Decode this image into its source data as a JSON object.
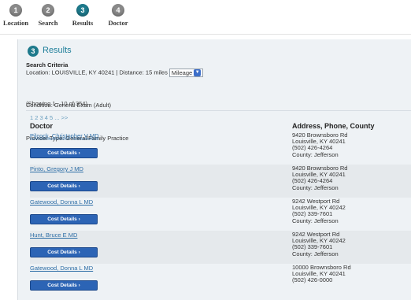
{
  "steps": [
    {
      "num": "1",
      "label": "Location",
      "active": false
    },
    {
      "num": "2",
      "label": "Search",
      "active": false
    },
    {
      "num": "3",
      "label": "Results",
      "active": true
    },
    {
      "num": "4",
      "label": "Doctor",
      "active": false
    }
  ],
  "results": {
    "num": "3",
    "title": "Results",
    "criteria_heading": "Search Criteria",
    "location_text": "Location: LOUISVILLE, KY 40241 | Distance: 15 miles",
    "distance_unit": "Mileage",
    "condition": "Condition: General Exam (Adult)",
    "provider_type": "Provider Type: General/Family Practice",
    "showing": "(Showing 1 - 10 of 354)",
    "pagination": "1 2 3 4 5 ... >>"
  },
  "columns": {
    "doctor": "Doctor",
    "address": "Address, Phone, County"
  },
  "cost_button_label": "Cost Details ›",
  "rows": [
    {
      "name": "Pilcock, Christopher V MD",
      "addr1": "9420 Brownsboro Rd",
      "addr2": "Louisville, KY 40241",
      "phone": "(502) 426-4264",
      "county": "County: Jefferson"
    },
    {
      "name": "Pinto, Gregory J MD",
      "addr1": "9420 Brownsboro Rd",
      "addr2": "Louisville, KY 40241",
      "phone": "(502) 426-4264",
      "county": "County: Jefferson"
    },
    {
      "name": "Gatewood, Donna L MD",
      "addr1": "9242 Westport Rd",
      "addr2": "Louisville, KY 40242",
      "phone": "(502) 339-7601",
      "county": "County: Jefferson"
    },
    {
      "name": "Hunt, Bruce E MD",
      "addr1": "9242 Westport Rd",
      "addr2": "Louisville, KY 40242",
      "phone": "(502) 339-7601",
      "county": "County: Jefferson"
    },
    {
      "name": "Gatewood, Donna L MD",
      "addr1": "10000 Brownsboro Rd",
      "addr2": "Louisville, KY 40241",
      "phone": "(502) 426-0000",
      "county": ""
    }
  ]
}
